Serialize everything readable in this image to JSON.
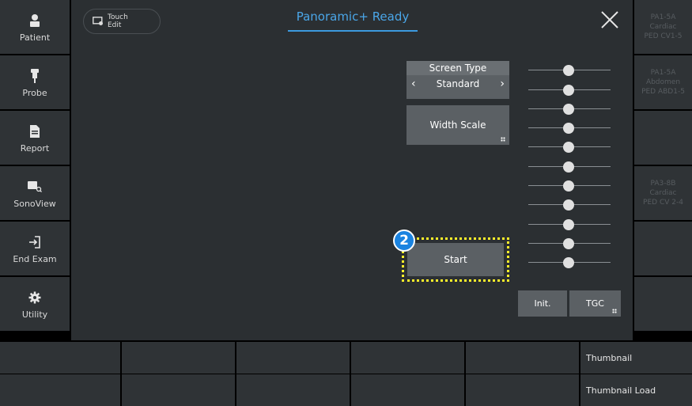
{
  "sidebar": {
    "items": [
      {
        "label": "Patient",
        "icon": "person-icon"
      },
      {
        "label": "Probe",
        "icon": "probe-icon"
      },
      {
        "label": "Report",
        "icon": "document-icon"
      },
      {
        "label": "SonoView",
        "icon": "image-search-icon"
      },
      {
        "label": "End Exam",
        "icon": "exit-icon"
      },
      {
        "label": "Utility",
        "icon": "gear-icon"
      }
    ]
  },
  "header": {
    "title": "Panoramic+ Ready",
    "touch_edit": "Touch Edit",
    "touch_edit_top": "Touch",
    "touch_edit_bottom": "Edit",
    "title_color": "#4aa6e8"
  },
  "controls": {
    "screen_type_label": "Screen Type",
    "screen_type_value": "Standard",
    "width_scale_label": "Width Scale",
    "start_label": "Start",
    "step_badge": "2",
    "init_label": "Init.",
    "tgc_label": "TGC",
    "highlight_color": "#fff12b",
    "badge_color": "#1a83e0"
  },
  "probes": [
    {
      "line1": "PA1-5A",
      "line2": "Cardiac",
      "line3": "PED CV1-5"
    },
    {
      "line1": "PA1-5A",
      "line2": "Abdomen",
      "line3": "PED ABD1-5"
    },
    {
      "line1": "",
      "line2": "",
      "line3": ""
    },
    {
      "line1": "PA3-8B",
      "line2": "Cardiac",
      "line3": "PED CV 2-4"
    },
    {
      "line1": "",
      "line2": "",
      "line3": ""
    },
    {
      "line1": "",
      "line2": "",
      "line3": ""
    }
  ],
  "bottom": {
    "thumbnail": "Thumbnail",
    "thumbnail_load": "Thumbnail Load"
  }
}
